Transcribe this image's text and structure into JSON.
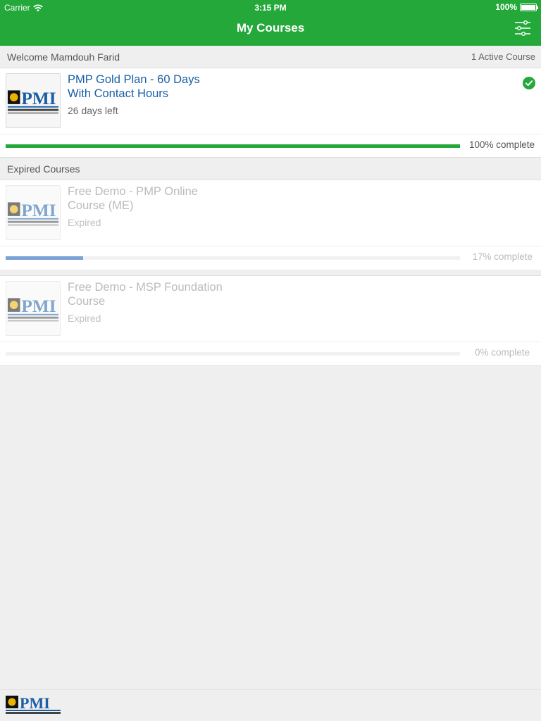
{
  "status_bar": {
    "carrier": "Carrier",
    "time": "3:15 PM",
    "battery": "100%"
  },
  "header": {
    "title": "My Courses",
    "filter_icon": "sliders-icon"
  },
  "active_section": {
    "welcome": "Welcome Mamdouh Farid",
    "count": "1 Active Course"
  },
  "active_courses": [
    {
      "title": "PMP Gold Plan - 60 Days With Contact Hours",
      "subtitle": "26 days left",
      "progress": 100,
      "progress_label": "100% complete",
      "completed_icon": "check-circle-icon",
      "progress_color": "#24a83a"
    }
  ],
  "expired_section": {
    "title": "Expired Courses"
  },
  "expired_courses": [
    {
      "title": "Free Demo - PMP Online Course (ME)",
      "subtitle": "Expired",
      "progress": 17,
      "progress_label": "17% complete",
      "progress_color": "#7aa2d6"
    },
    {
      "title": "Free Demo - MSP Foundation Course",
      "subtitle": "Expired",
      "progress": 0,
      "progress_label": "0% complete",
      "progress_color": "#7aa2d6"
    }
  ],
  "colors": {
    "brand_green": "#24a83a",
    "title_blue": "#1a5fa6"
  }
}
